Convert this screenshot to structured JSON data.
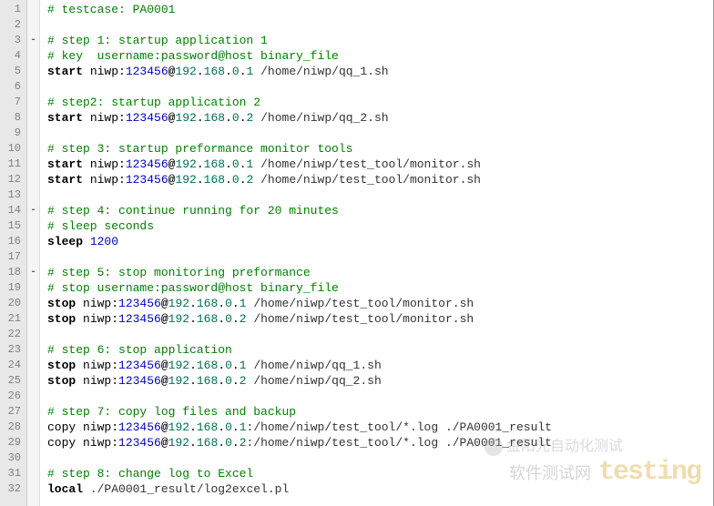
{
  "lines": [
    {
      "n": 1,
      "fold": "",
      "tokens": [
        {
          "t": "# testcase: PA0001",
          "c": "comment"
        }
      ]
    },
    {
      "n": 2,
      "fold": "",
      "tokens": []
    },
    {
      "n": 3,
      "fold": "-",
      "tokens": [
        {
          "t": "# step 1: startup application 1",
          "c": "comment"
        }
      ]
    },
    {
      "n": 4,
      "fold": "",
      "tokens": [
        {
          "t": "# key  username:password@host binary_file",
          "c": "comment"
        }
      ]
    },
    {
      "n": 5,
      "fold": "",
      "tokens": [
        {
          "t": "start",
          "c": "keyword"
        },
        {
          "t": " niwp:",
          "c": "plain"
        },
        {
          "t": "123456",
          "c": "number"
        },
        {
          "t": "@",
          "c": "at"
        },
        {
          "t": "192",
          "c": "ip"
        },
        {
          "t": ".",
          "c": "plain"
        },
        {
          "t": "168",
          "c": "ip"
        },
        {
          "t": ".",
          "c": "plain"
        },
        {
          "t": "0",
          "c": "ip"
        },
        {
          "t": ".",
          "c": "plain"
        },
        {
          "t": "1",
          "c": "ip"
        },
        {
          "t": " /home/niwp/qq_1.sh",
          "c": "path"
        }
      ]
    },
    {
      "n": 6,
      "fold": "",
      "tokens": []
    },
    {
      "n": 7,
      "fold": "",
      "tokens": [
        {
          "t": "# step2: startup application 2",
          "c": "comment"
        }
      ]
    },
    {
      "n": 8,
      "fold": "",
      "tokens": [
        {
          "t": "start",
          "c": "keyword"
        },
        {
          "t": " niwp:",
          "c": "plain"
        },
        {
          "t": "123456",
          "c": "number"
        },
        {
          "t": "@",
          "c": "at"
        },
        {
          "t": "192",
          "c": "ip"
        },
        {
          "t": ".",
          "c": "plain"
        },
        {
          "t": "168",
          "c": "ip"
        },
        {
          "t": ".",
          "c": "plain"
        },
        {
          "t": "0",
          "c": "ip"
        },
        {
          "t": ".",
          "c": "plain"
        },
        {
          "t": "2",
          "c": "ip"
        },
        {
          "t": " /home/niwp/qq_2.sh",
          "c": "path"
        }
      ]
    },
    {
      "n": 9,
      "fold": "",
      "tokens": []
    },
    {
      "n": 10,
      "fold": "",
      "tokens": [
        {
          "t": "# step 3: startup preformance monitor tools",
          "c": "comment"
        }
      ]
    },
    {
      "n": 11,
      "fold": "",
      "tokens": [
        {
          "t": "start",
          "c": "keyword"
        },
        {
          "t": " niwp:",
          "c": "plain"
        },
        {
          "t": "123456",
          "c": "number"
        },
        {
          "t": "@",
          "c": "at"
        },
        {
          "t": "192",
          "c": "ip"
        },
        {
          "t": ".",
          "c": "plain"
        },
        {
          "t": "168",
          "c": "ip"
        },
        {
          "t": ".",
          "c": "plain"
        },
        {
          "t": "0",
          "c": "ip"
        },
        {
          "t": ".",
          "c": "plain"
        },
        {
          "t": "1",
          "c": "ip"
        },
        {
          "t": " /home/niwp/test_tool/monitor.sh",
          "c": "path"
        }
      ]
    },
    {
      "n": 12,
      "fold": "",
      "tokens": [
        {
          "t": "start",
          "c": "keyword"
        },
        {
          "t": " niwp:",
          "c": "plain"
        },
        {
          "t": "123456",
          "c": "number"
        },
        {
          "t": "@",
          "c": "at"
        },
        {
          "t": "192",
          "c": "ip"
        },
        {
          "t": ".",
          "c": "plain"
        },
        {
          "t": "168",
          "c": "ip"
        },
        {
          "t": ".",
          "c": "plain"
        },
        {
          "t": "0",
          "c": "ip"
        },
        {
          "t": ".",
          "c": "plain"
        },
        {
          "t": "2",
          "c": "ip"
        },
        {
          "t": " /home/niwp/test_tool/monitor.sh",
          "c": "path"
        }
      ]
    },
    {
      "n": 13,
      "fold": "",
      "tokens": []
    },
    {
      "n": 14,
      "fold": "-",
      "tokens": [
        {
          "t": "# step 4: continue running for 20 minutes",
          "c": "comment"
        }
      ]
    },
    {
      "n": 15,
      "fold": "",
      "tokens": [
        {
          "t": "# sleep seconds",
          "c": "comment"
        }
      ]
    },
    {
      "n": 16,
      "fold": "",
      "tokens": [
        {
          "t": "sleep",
          "c": "keyword"
        },
        {
          "t": " ",
          "c": "plain"
        },
        {
          "t": "1200",
          "c": "number"
        }
      ]
    },
    {
      "n": 17,
      "fold": "",
      "tokens": []
    },
    {
      "n": 18,
      "fold": "-",
      "tokens": [
        {
          "t": "# step 5: stop monitoring preformance",
          "c": "comment"
        }
      ]
    },
    {
      "n": 19,
      "fold": "",
      "tokens": [
        {
          "t": "# stop username:password@host binary_file",
          "c": "comment"
        }
      ]
    },
    {
      "n": 20,
      "fold": "",
      "tokens": [
        {
          "t": "stop",
          "c": "keyword"
        },
        {
          "t": " niwp:",
          "c": "plain"
        },
        {
          "t": "123456",
          "c": "number"
        },
        {
          "t": "@",
          "c": "at"
        },
        {
          "t": "192",
          "c": "ip"
        },
        {
          "t": ".",
          "c": "plain"
        },
        {
          "t": "168",
          "c": "ip"
        },
        {
          "t": ".",
          "c": "plain"
        },
        {
          "t": "0",
          "c": "ip"
        },
        {
          "t": ".",
          "c": "plain"
        },
        {
          "t": "1",
          "c": "ip"
        },
        {
          "t": " /home/niwp/test_tool/monitor.sh",
          "c": "path"
        }
      ]
    },
    {
      "n": 21,
      "fold": "",
      "tokens": [
        {
          "t": "stop",
          "c": "keyword"
        },
        {
          "t": " niwp:",
          "c": "plain"
        },
        {
          "t": "123456",
          "c": "number"
        },
        {
          "t": "@",
          "c": "at"
        },
        {
          "t": "192",
          "c": "ip"
        },
        {
          "t": ".",
          "c": "plain"
        },
        {
          "t": "168",
          "c": "ip"
        },
        {
          "t": ".",
          "c": "plain"
        },
        {
          "t": "0",
          "c": "ip"
        },
        {
          "t": ".",
          "c": "plain"
        },
        {
          "t": "2",
          "c": "ip"
        },
        {
          "t": " /home/niwp/test_tool/monitor.sh",
          "c": "path"
        }
      ]
    },
    {
      "n": 22,
      "fold": "",
      "tokens": []
    },
    {
      "n": 23,
      "fold": "",
      "tokens": [
        {
          "t": "# step 6: stop application",
          "c": "comment"
        }
      ]
    },
    {
      "n": 24,
      "fold": "",
      "tokens": [
        {
          "t": "stop",
          "c": "keyword"
        },
        {
          "t": " niwp:",
          "c": "plain"
        },
        {
          "t": "123456",
          "c": "number"
        },
        {
          "t": "@",
          "c": "at"
        },
        {
          "t": "192",
          "c": "ip"
        },
        {
          "t": ".",
          "c": "plain"
        },
        {
          "t": "168",
          "c": "ip"
        },
        {
          "t": ".",
          "c": "plain"
        },
        {
          "t": "0",
          "c": "ip"
        },
        {
          "t": ".",
          "c": "plain"
        },
        {
          "t": "1",
          "c": "ip"
        },
        {
          "t": " /home/niwp/qq_1.sh",
          "c": "path"
        }
      ]
    },
    {
      "n": 25,
      "fold": "",
      "tokens": [
        {
          "t": "stop",
          "c": "keyword"
        },
        {
          "t": " niwp:",
          "c": "plain"
        },
        {
          "t": "123456",
          "c": "number"
        },
        {
          "t": "@",
          "c": "at"
        },
        {
          "t": "192",
          "c": "ip"
        },
        {
          "t": ".",
          "c": "plain"
        },
        {
          "t": "168",
          "c": "ip"
        },
        {
          "t": ".",
          "c": "plain"
        },
        {
          "t": "0",
          "c": "ip"
        },
        {
          "t": ".",
          "c": "plain"
        },
        {
          "t": "2",
          "c": "ip"
        },
        {
          "t": " /home/niwp/qq_2.sh",
          "c": "path"
        }
      ]
    },
    {
      "n": 26,
      "fold": "",
      "tokens": []
    },
    {
      "n": 27,
      "fold": "",
      "tokens": [
        {
          "t": "# step 7: copy log files and backup",
          "c": "comment"
        }
      ]
    },
    {
      "n": 28,
      "fold": "",
      "tokens": [
        {
          "t": "copy niwp:",
          "c": "plain"
        },
        {
          "t": "123456",
          "c": "number"
        },
        {
          "t": "@",
          "c": "at"
        },
        {
          "t": "192",
          "c": "ip"
        },
        {
          "t": ".",
          "c": "plain"
        },
        {
          "t": "168",
          "c": "ip"
        },
        {
          "t": ".",
          "c": "plain"
        },
        {
          "t": "0",
          "c": "ip"
        },
        {
          "t": ".",
          "c": "plain"
        },
        {
          "t": "1",
          "c": "ip"
        },
        {
          "t": ":/home/niwp/test_tool/*.log ./PA0001_result",
          "c": "path"
        }
      ]
    },
    {
      "n": 29,
      "fold": "",
      "tokens": [
        {
          "t": "copy niwp:",
          "c": "plain"
        },
        {
          "t": "123456",
          "c": "number"
        },
        {
          "t": "@",
          "c": "at"
        },
        {
          "t": "192",
          "c": "ip"
        },
        {
          "t": ".",
          "c": "plain"
        },
        {
          "t": "168",
          "c": "ip"
        },
        {
          "t": ".",
          "c": "plain"
        },
        {
          "t": "0",
          "c": "ip"
        },
        {
          "t": ".",
          "c": "plain"
        },
        {
          "t": "2",
          "c": "ip"
        },
        {
          "t": ":/home/niwp/test_tool/*.log ./PA0001_result",
          "c": "path"
        }
      ]
    },
    {
      "n": 30,
      "fold": "",
      "tokens": []
    },
    {
      "n": 31,
      "fold": "",
      "tokens": [
        {
          "t": "# step 8: change log to Excel",
          "c": "comment"
        }
      ]
    },
    {
      "n": 32,
      "fold": "",
      "tokens": [
        {
          "t": "local",
          "c": "keyword"
        },
        {
          "t": " ./PA0001_result/log2excel.pl",
          "c": "path"
        }
      ]
    }
  ],
  "watermark": {
    "line1": "金阳光自动化测试",
    "line2": "软件测试网",
    "logo_text": "testing"
  }
}
